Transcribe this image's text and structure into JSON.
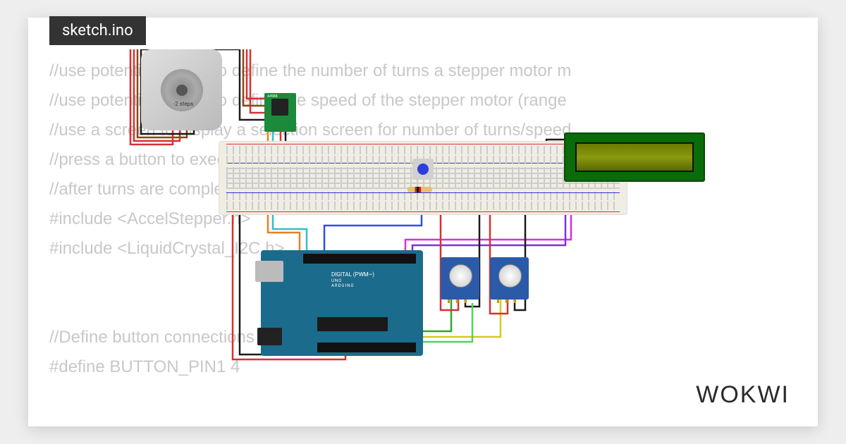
{
  "filename": "sketch.ino",
  "brand": "WOKWI",
  "code_lines": [
    "//use potentiometer 1 to define the number of turns a stepper motor m",
    "//use potentiometer 2 to define the speed of the stepper motor (range",
    "//use a screen to display a selection screen for number of turns/speed",
    "//press a button to execute the selected number of turns, once executed th",
    "//after turns are completed the screen should be returned to turn/speed sele",
    "#include <AccelStepper.h>",
    "#include <LiquidCrystal_I2C.h>",
    "",
    "",
    "//Define button connections",
    "#define BUTTON_PIN1 4"
  ],
  "components": {
    "stepper": {
      "label": "-2\nsteps"
    },
    "driver": {
      "label": "A4988"
    },
    "arduino": {
      "label1": "DIGITAL (PWM~)",
      "label2": "UNO",
      "label3": "ARDUINO"
    },
    "breadboard": {},
    "lcd": {},
    "push_button": {},
    "resistor": {},
    "potentiometer_1": {},
    "potentiometer_2": {}
  },
  "wire_colors": {
    "red": "#d83030",
    "black": "#1a1a1a",
    "green": "#2aa82a",
    "blue": "#3050e0",
    "magenta": "#d830d8",
    "cyan": "#30c0d0",
    "orange": "#e88020",
    "yellow": "#d8c820",
    "limegreen": "#50d850",
    "violet": "#8030d8",
    "brown": "#8b4513"
  }
}
